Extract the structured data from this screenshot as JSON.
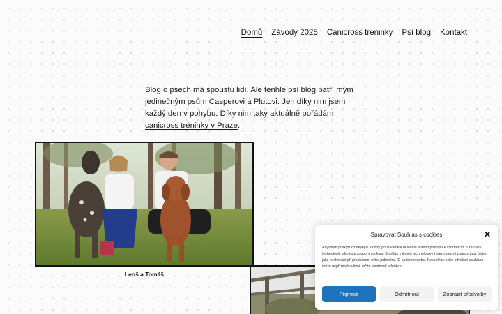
{
  "nav": {
    "items": [
      {
        "label": "Domů",
        "active": true
      },
      {
        "label": "Závody 2025",
        "active": false
      },
      {
        "label": "Canicross tréninky",
        "active": false
      },
      {
        "label": "Psí blog",
        "active": false
      },
      {
        "label": "Kontakt",
        "active": false
      }
    ]
  },
  "intro": {
    "text": "Blog o psech má spoustu lidí. Ale tenhle psí blog patří mým jedinečným psům Casperovi a Plutovi. Jen díky nim jsem každý den v pohybu. Díky nim taky aktuálně pořádám ",
    "link": "canicross tréninky v Praze",
    "end": "."
  },
  "photos": {
    "first_caption": "Leoš a Tomáš"
  },
  "cookie": {
    "title": "Spravovat Souhlas s cookies",
    "text": "Abychom poskytli co nejlepší služby, používáme k ukládání a/nebo přístupu k informacím o zařízení, technologie jako jsou soubory cookies. Souhlas s těmito technologiemi nám umožní zpracovávat údaje, jako je chování při procházení nebo jedinečná ID na tomto webu. Nesouhlas nebo odvolání souhlasu může nepříznivě ovlivnit určité vlastnosti a funkce.",
    "accept": "Přijmout",
    "deny": "Odmítnout",
    "prefs": "Zobrazit předvolby"
  },
  "colors": {
    "accent": "#1e73be",
    "button_gray": "#f3f3f3"
  }
}
